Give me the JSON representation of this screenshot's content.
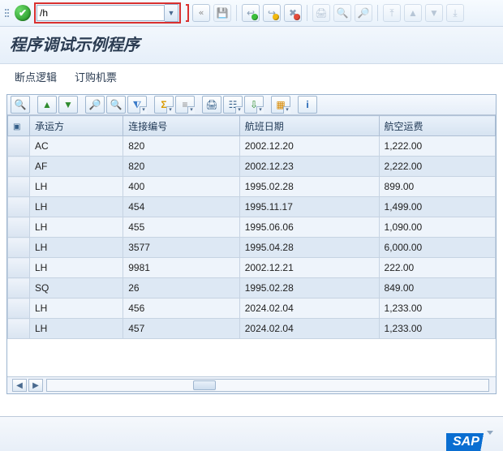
{
  "command_field": {
    "value": "/h"
  },
  "title": "程序调试示例程序",
  "menu": {
    "breakpoint": "断点逻辑",
    "book": "订购机票"
  },
  "table": {
    "headers": {
      "carrier": "承运方",
      "conn": "连接编号",
      "date": "航班日期",
      "fare": "航空运费"
    },
    "rows": [
      {
        "carrier": "AC",
        "conn": "820",
        "date": "2002.12.20",
        "fare": "1,222.00"
      },
      {
        "carrier": "AF",
        "conn": "820",
        "date": "2002.12.23",
        "fare": "2,222.00"
      },
      {
        "carrier": "LH",
        "conn": "400",
        "date": "1995.02.28",
        "fare": "899.00"
      },
      {
        "carrier": "LH",
        "conn": "454",
        "date": "1995.11.17",
        "fare": "1,499.00"
      },
      {
        "carrier": "LH",
        "conn": "455",
        "date": "1995.06.06",
        "fare": "1,090.00"
      },
      {
        "carrier": "LH",
        "conn": "3577",
        "date": "1995.04.28",
        "fare": "6,000.00"
      },
      {
        "carrier": "LH",
        "conn": "9981",
        "date": "2002.12.21",
        "fare": "222.00"
      },
      {
        "carrier": "SQ",
        "conn": "26",
        "date": "1995.02.28",
        "fare": "849.00"
      },
      {
        "carrier": "LH",
        "conn": "456",
        "date": "2024.02.04",
        "fare": "1,233.00"
      },
      {
        "carrier": "LH",
        "conn": "457",
        "date": "2024.02.04",
        "fare": "1,233.00"
      }
    ]
  },
  "logo": "SAP"
}
